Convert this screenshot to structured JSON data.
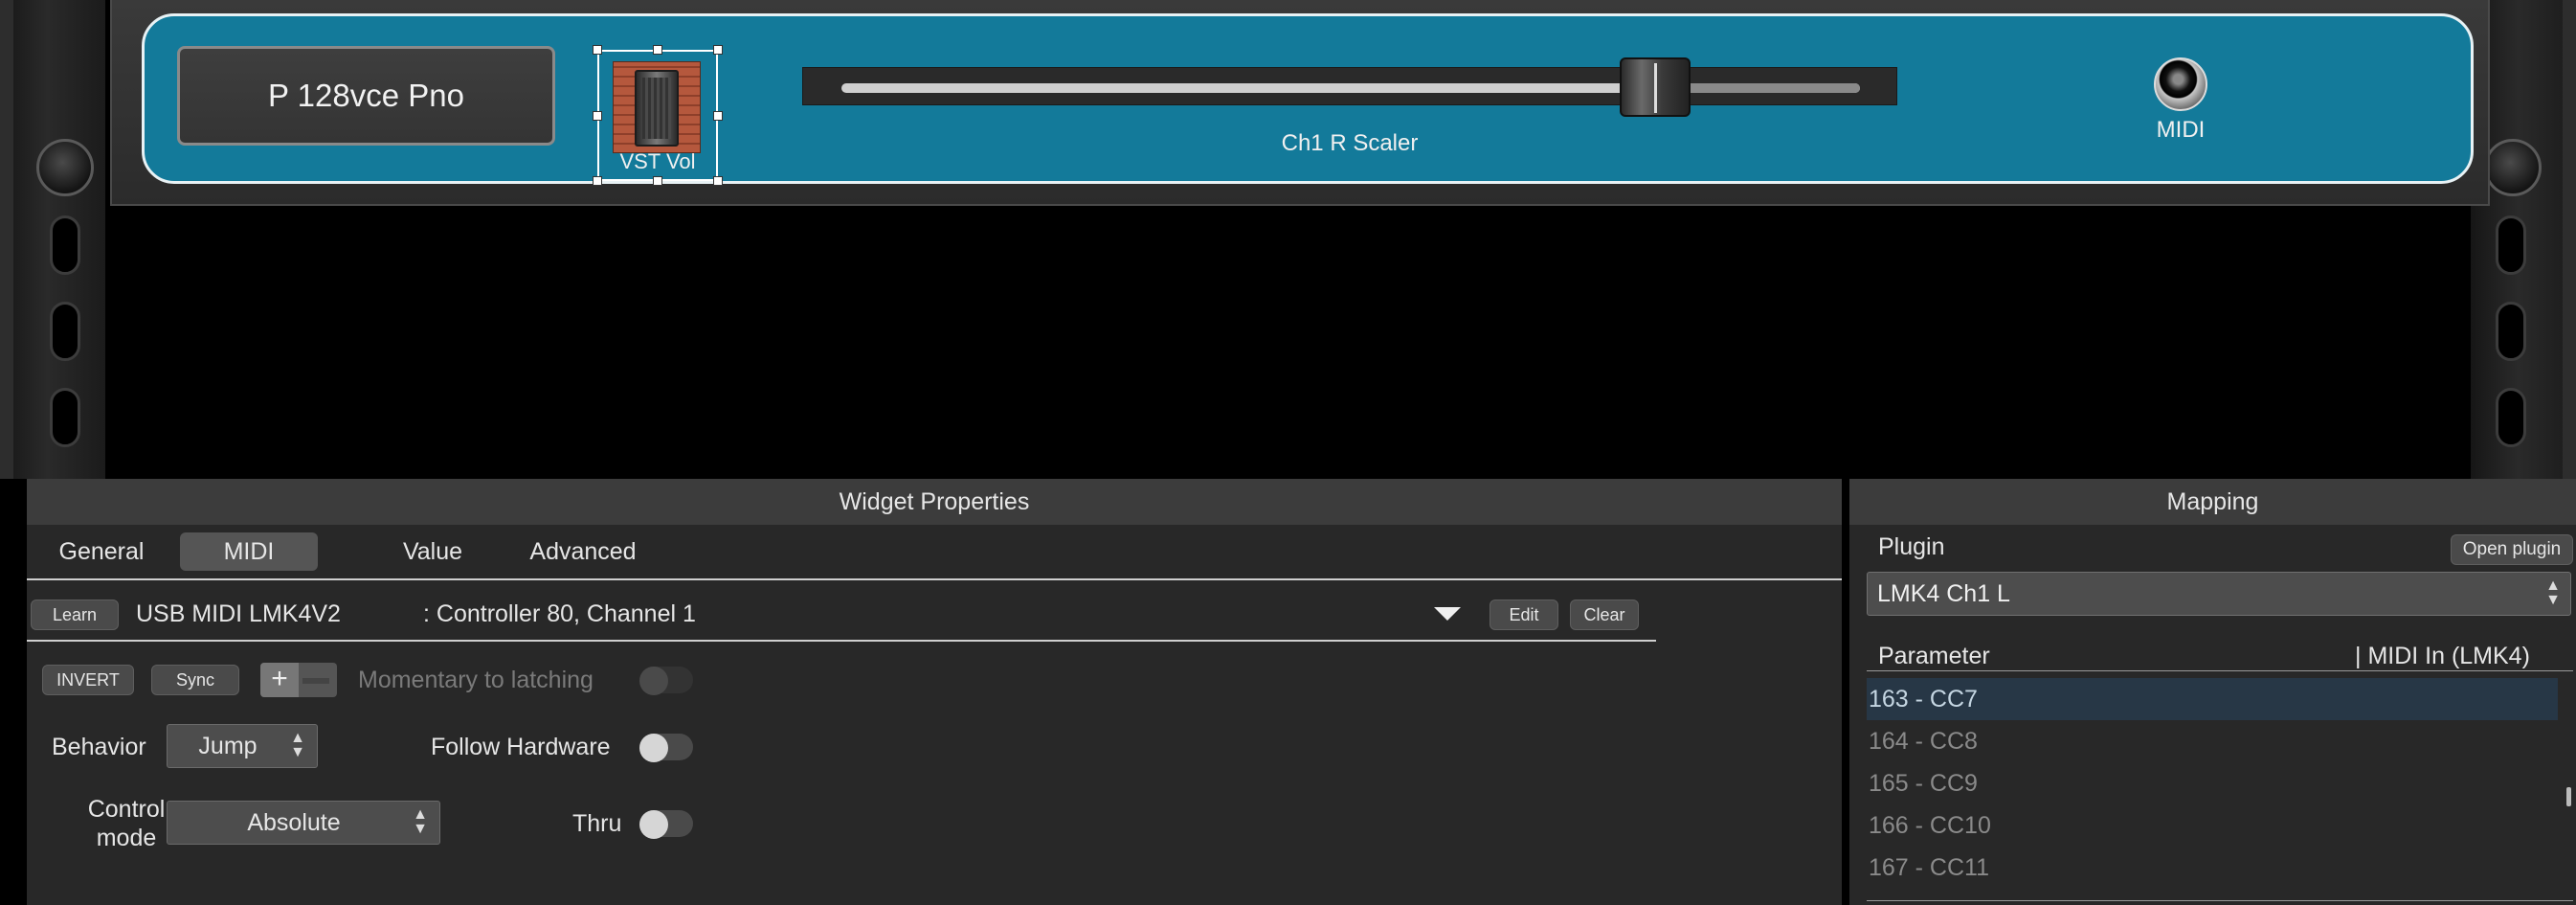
{
  "rack": {
    "name_display": "P 128vce Pno",
    "vst_widget": {
      "label": "VST Vol",
      "icon": "fader-icon"
    },
    "slider": {
      "label": "Ch1 R Scaler",
      "value": 0.82
    },
    "midi_jack": {
      "label": "MIDI",
      "icon": "midi-jack-icon"
    }
  },
  "widget_properties": {
    "header": "Widget Properties",
    "tabs": [
      {
        "label": "General",
        "active": false
      },
      {
        "label": "MIDI",
        "active": true
      },
      {
        "label": "Value",
        "active": false
      },
      {
        "label": "Advanced",
        "active": false
      }
    ],
    "midi": {
      "learn_label": "Learn",
      "device": "USB MIDI LMK4V2",
      "assignment": ": Controller 80, Channel 1",
      "edit_label": "Edit",
      "clear_label": "Clear",
      "invert_label": "INVERT",
      "sync_label": "Sync",
      "stepper_plus": "+",
      "momentary_label": "Momentary to latching",
      "momentary_on": false,
      "behavior_label": "Behavior",
      "behavior_value": "Jump",
      "follow_hardware_label": "Follow Hardware",
      "follow_hardware_on": false,
      "control_mode_label_1": "Control",
      "control_mode_label_2": "mode",
      "control_mode_value": "Absolute",
      "thru_label": "Thru",
      "thru_on": false
    }
  },
  "mapping": {
    "header": "Mapping",
    "plugin_label": "Plugin",
    "open_plugin_label": "Open plugin",
    "plugin_value": "LMK4 Ch1 L",
    "parameter_header": "Parameter",
    "midi_in_header": "| MIDI In (LMK4)",
    "parameters": [
      {
        "label": "163 - CC7",
        "selected": true
      },
      {
        "label": "164 - CC8",
        "selected": false
      },
      {
        "label": "165 - CC9",
        "selected": false
      },
      {
        "label": "166 - CC10",
        "selected": false
      },
      {
        "label": "167 - CC11",
        "selected": false
      }
    ]
  },
  "colors": {
    "rack_frame": "#137a9a",
    "selected_row": "#273746",
    "panel_bg": "#282828",
    "header_bg": "#3c3c3c"
  }
}
